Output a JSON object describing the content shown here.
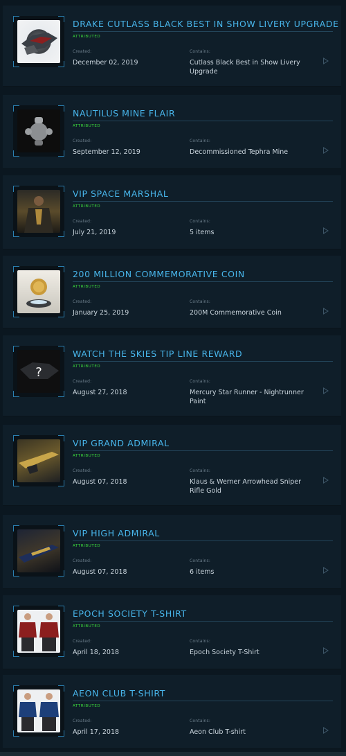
{
  "labels": {
    "status": "ATTRIBUTED",
    "created": "Created:",
    "contains": "Contains:"
  },
  "items": [
    {
      "title": "DRAKE CUTLASS BLACK BEST IN SHOW LIVERY UPGRADE",
      "created": "December 02, 2019",
      "contains": "Cutlass Black Best in Show Livery Upgrade",
      "icon": "ship-icon"
    },
    {
      "title": "NAUTILUS MINE FLAIR",
      "created": "September 12, 2019",
      "contains": "Decommissioned Tephra Mine",
      "icon": "mine-icon"
    },
    {
      "title": "VIP SPACE MARSHAL",
      "created": "July 21, 2019",
      "contains": "5 items",
      "icon": "marshal-icon"
    },
    {
      "title": "200 MILLION COMMEMORATIVE COIN",
      "created": "January 25, 2019",
      "contains": "200M Commemorative Coin",
      "icon": "coin-icon"
    },
    {
      "title": "WATCH THE SKIES TIP LINE REWARD",
      "created": "August 27, 2018",
      "contains": "Mercury Star Runner - Nightrunner Paint",
      "icon": "mystery-icon"
    },
    {
      "title": "VIP GRAND ADMIRAL",
      "created": "August 07, 2018",
      "contains": "Klaus & Werner Arrowhead Sniper Rifle Gold",
      "icon": "rifle-icon"
    },
    {
      "title": "VIP HIGH ADMIRAL",
      "created": "August 07, 2018",
      "contains": "6 items",
      "icon": "rifle-icon"
    },
    {
      "title": "EPOCH SOCIETY T-SHIRT",
      "created": "April 18, 2018",
      "contains": "Epoch Society T-Shirt",
      "icon": "tshirt-icon"
    },
    {
      "title": "AEON CLUB T-SHIRT",
      "created": "April 17, 2018",
      "contains": "Aeon Club T-shirt",
      "icon": "tshirt-icon"
    }
  ],
  "colors": {
    "accent": "#48b5ea",
    "status": "#3ddc3d",
    "background": "#0b1720",
    "card": "#0f1e29"
  }
}
